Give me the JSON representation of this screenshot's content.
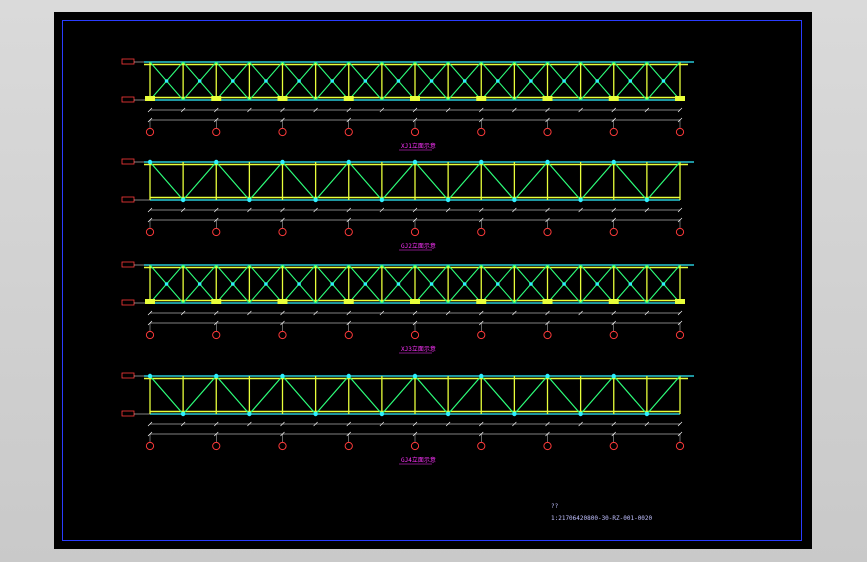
{
  "drawing": {
    "colors": {
      "chord": "#e8ff3a",
      "web": "#2dff7a",
      "accent": "#2ff0ff",
      "dim": "#ffffff",
      "axis_bubble": "#ff3a3a",
      "label": "#ff33ff",
      "frame": "#2a3cff"
    },
    "trusses": [
      {
        "label": "XJ1立面示意",
        "pattern": "x"
      },
      {
        "label": "GJ2立面示意",
        "pattern": "v"
      },
      {
        "label": "XJ3立面示意",
        "pattern": "x"
      },
      {
        "label": "GJ4立面示意",
        "pattern": "v"
      }
    ],
    "title_block": {
      "line1": "??",
      "line2": "1:21706420800-30-RZ-001-0020"
    }
  }
}
